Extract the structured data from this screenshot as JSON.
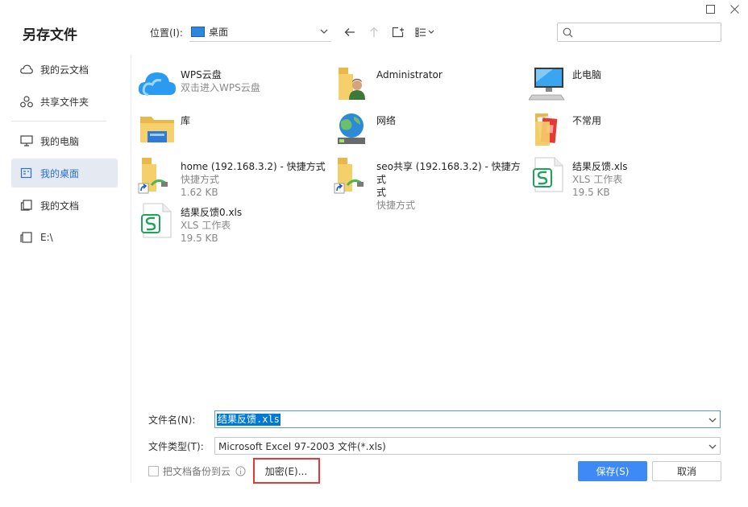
{
  "window": {
    "title": "另存文件"
  },
  "sidebar": {
    "items": [
      {
        "label": "我的云文档",
        "icon": "cloud-icon"
      },
      {
        "label": "共享文件夹",
        "icon": "share-icon"
      },
      {
        "label": "我的电脑",
        "icon": "monitor-icon"
      },
      {
        "label": "我的桌面",
        "icon": "desktop-icon",
        "active": true
      },
      {
        "label": "我的文档",
        "icon": "documents-icon"
      },
      {
        "label": "E:\\",
        "icon": "drive-icon"
      }
    ]
  },
  "toolbar": {
    "location_label": "位置(I):",
    "location_value": "桌面"
  },
  "files": [
    {
      "name": "WPS云盘",
      "sub1": "双击进入WPS云盘",
      "sub2": "",
      "icon": "wps-cloud-icon"
    },
    {
      "name": "Administrator",
      "sub1": "",
      "sub2": "",
      "icon": "user-folder-icon"
    },
    {
      "name": "此电脑",
      "sub1": "",
      "sub2": "",
      "icon": "computer-icon"
    },
    {
      "name": "库",
      "sub1": "",
      "sub2": "",
      "icon": "library-folder-icon"
    },
    {
      "name": "网络",
      "sub1": "",
      "sub2": "",
      "icon": "network-icon"
    },
    {
      "name": "不常用",
      "sub1": "",
      "sub2": "",
      "icon": "folder-icon"
    },
    {
      "name": "home (192.168.3.2) - 快捷方式",
      "sub1": "快捷方式",
      "sub2": "1.62 KB",
      "icon": "shortcut-folder-icon"
    },
    {
      "name": "seo共享 (192.168.3.2) - 快捷方式",
      "name2": "式",
      "sub1": "快捷方式",
      "sub2": "",
      "icon": "shortcut-folder-icon"
    },
    {
      "name": "结果反馈.xls",
      "sub1": "XLS 工作表",
      "sub2": "19.5 KB",
      "icon": "xls-file-icon"
    },
    {
      "name": "结果反馈0.xls",
      "sub1": "XLS 工作表",
      "sub2": "19.5 KB",
      "icon": "xls-file-icon"
    }
  ],
  "form": {
    "filename_label": "文件名(N):",
    "filename_value": "结果反馈.xls",
    "filetype_label": "文件类型(T):",
    "filetype_value": "Microsoft Excel 97-2003 文件(*.xls)",
    "backup_label": "把文档备份到云",
    "encrypt_label": "加密(E)...",
    "save_label": "保存(S)",
    "cancel_label": "取消"
  },
  "colors": {
    "accent": "#3d8af7",
    "highlight": "#e53935",
    "selected_bg": "#e4e9f2"
  }
}
